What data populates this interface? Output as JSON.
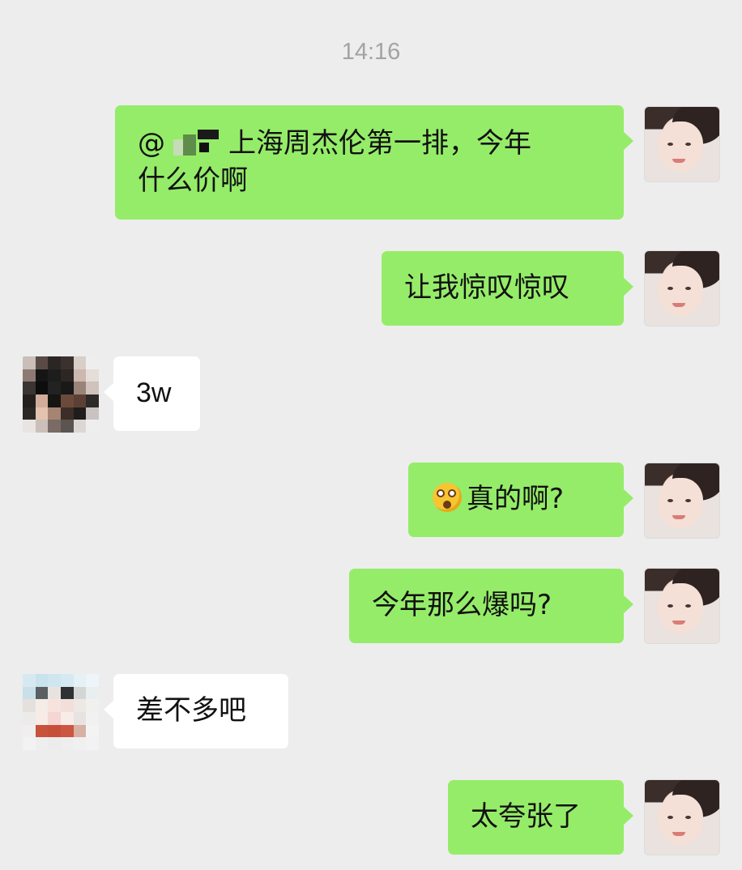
{
  "timestamp": "14:16",
  "messages": [
    {
      "side": "out",
      "prefix": "@",
      "text": "上海周杰伦第一排，今年",
      "text2": "什么价啊"
    },
    {
      "side": "out",
      "text": "让我惊叹惊叹"
    },
    {
      "side": "in",
      "text": "3w"
    },
    {
      "side": "out",
      "emoji": "surprised-face-icon",
      "text": "真的啊?"
    },
    {
      "side": "out",
      "text": "今年那么爆吗?"
    },
    {
      "side": "in",
      "text": "差不多吧"
    },
    {
      "side": "out",
      "text": "太夸张了"
    }
  ],
  "colors": {
    "background": "#ededed",
    "outgoing_bubble": "#95ec69",
    "incoming_bubble": "#ffffff",
    "timestamp": "#a3a3a3"
  }
}
